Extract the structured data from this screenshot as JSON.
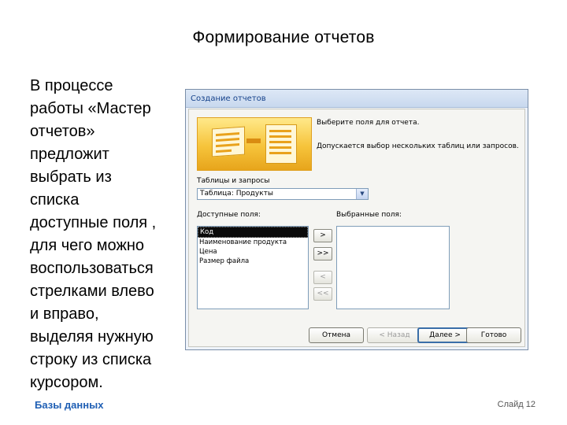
{
  "slide": {
    "title": "Формирование отчетов",
    "body": "В процессе\nработы «Мастер\nотчетов»\nпредложит\nвыбрать из\nсписка\nдоступные поля ,\nдля чего можно\nвоспользоваться\nстрелками влево\nи вправо,\nвыделяя нужную\nстроку из списка\nкурсором.",
    "footer_left": "Базы данных",
    "footer_right": "Слайд 12"
  },
  "dialog": {
    "title": "Создание отчетов",
    "instruction1": "Выберите поля для отчета.",
    "instruction2": "Допускается выбор нескольких таблиц или запросов.",
    "tables_label": "Таблицы и запросы",
    "table_select_value": "Таблица: Продукты",
    "available_label": "Доступные поля:",
    "selected_label": "Выбранные поля:",
    "available_fields": [
      "Код",
      "Наименование продукта",
      "Цена",
      "Размер файла"
    ],
    "selected_fields": [],
    "move_buttons": {
      "add_one": ">",
      "add_all": ">>",
      "remove_one": "<",
      "remove_all": "<<"
    },
    "buttons": {
      "cancel": "Отмена",
      "back": "< Назад",
      "next": "Далее >",
      "finish": "Готово"
    }
  },
  "colors": {
    "footer_accent": "#1f5fb4",
    "dialog_title": "#15428b",
    "wizard_art": "#f6c33a"
  },
  "icons": {
    "select_arrow": "chevron-down-icon",
    "wizard_art": "report-wizard-icon"
  }
}
